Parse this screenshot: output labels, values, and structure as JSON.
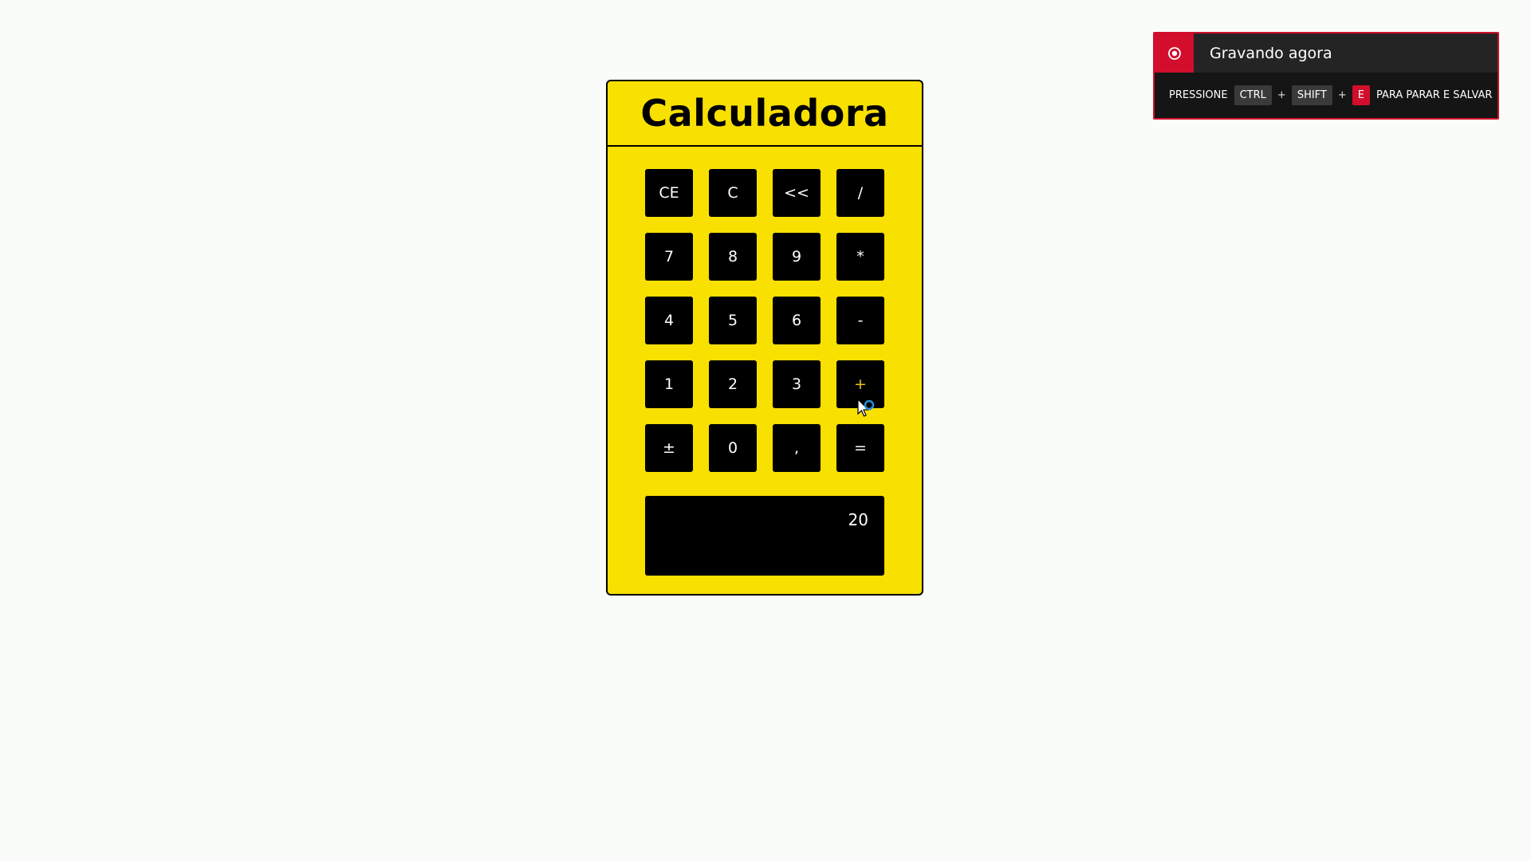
{
  "calculator": {
    "title": "Calculadora",
    "keys": [
      {
        "label": "CE",
        "name": "clear-entry-button"
      },
      {
        "label": "C",
        "name": "clear-button"
      },
      {
        "label": "<<",
        "name": "backspace-button"
      },
      {
        "label": "/",
        "name": "divide-button"
      },
      {
        "label": "7",
        "name": "digit-7-button"
      },
      {
        "label": "8",
        "name": "digit-8-button"
      },
      {
        "label": "9",
        "name": "digit-9-button"
      },
      {
        "label": "*",
        "name": "multiply-button"
      },
      {
        "label": "4",
        "name": "digit-4-button"
      },
      {
        "label": "5",
        "name": "digit-5-button"
      },
      {
        "label": "6",
        "name": "digit-6-button"
      },
      {
        "label": "-",
        "name": "subtract-button"
      },
      {
        "label": "1",
        "name": "digit-1-button"
      },
      {
        "label": "2",
        "name": "digit-2-button"
      },
      {
        "label": "3",
        "name": "digit-3-button"
      },
      {
        "label": "+",
        "name": "add-button",
        "active": true
      },
      {
        "label": "±",
        "name": "sign-toggle-button"
      },
      {
        "label": "0",
        "name": "digit-0-button"
      },
      {
        "label": ",",
        "name": "decimal-button"
      },
      {
        "label": "=",
        "name": "equals-button"
      }
    ],
    "display_value": "20"
  },
  "recording": {
    "title": "Gravando agora",
    "press_label": "PRESSIONE",
    "keys": [
      "CTRL",
      "SHIFT",
      "E"
    ],
    "plus": "+",
    "action_label": "PARA PARAR E SALVAR",
    "icon": "record-icon"
  },
  "colors": {
    "calculator_bg": "#f8e000",
    "key_bg": "#000000",
    "key_active_text": "#f0c020",
    "recording_accent": "#d20e2c"
  }
}
